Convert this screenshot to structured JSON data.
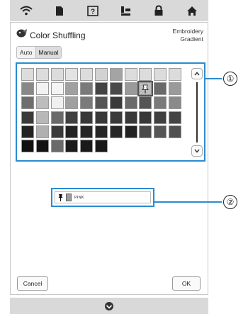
{
  "topbar": {
    "icons": [
      "wifi-icon",
      "document-icon",
      "help-icon",
      "embroidery-frame-icon",
      "lock-icon",
      "home-icon"
    ]
  },
  "header": {
    "title": "Color Shuffling",
    "mode_line1": "Embroidery",
    "mode_line2": "Gradient"
  },
  "tabs": {
    "auto_label": "Auto",
    "manual_label": "Manual",
    "active": "Manual"
  },
  "palette": {
    "rows": [
      [
        "#dcdcdc",
        "#dcdcdc",
        "#dcdcdc",
        "#e3e3e3",
        "#dcdcdc",
        "#d2d2d2",
        "#a4a4a4",
        "#dcdcdc",
        "#dcdcdc",
        "#dcdcdc",
        "#dcdcdc"
      ],
      [
        "#888888",
        "#f2f2f2",
        "#f4f4f4",
        "#a0a0a0",
        "#7a7a7a",
        "#444444",
        "#4a4a4a",
        "#9a9a9a",
        "#bdbdbd",
        "#6a6a6a",
        "#9a9a9a"
      ],
      [
        "#6e6e6e",
        "#bdbdbd",
        "#f0f0f0",
        "#a0a0a0",
        "#7a7a7a",
        "#555555",
        "#3a3a3a",
        "#6a6a6a",
        "#555555",
        "#7a7a7a",
        "#8a8a8a"
      ],
      [
        "#3a3a3a",
        "#b8b8b8",
        "#6a6a6a",
        "#404040",
        "#383838",
        "#383838",
        "#3a3a3a",
        "#383838",
        "#383838",
        "#404040",
        "#444444"
      ],
      [
        "#222222",
        "#b0b0b0",
        "#3a3a3a",
        "#222222",
        "#262626",
        "#262626",
        "#262626",
        "#222222",
        "#4a4a4a",
        "#555555",
        "#505050"
      ],
      [
        "#111111",
        "#141414",
        "#6a6a6a",
        "#1a1a1a",
        "#1a1a1a",
        "#181818"
      ]
    ],
    "selected_row": 1,
    "selected_col": 8,
    "selected_icon": "pin-icon"
  },
  "scroll": {
    "up_icon": "chevron-up-icon",
    "down_icon": "chevron-down-icon"
  },
  "selected_thread": {
    "icon": "pin-icon",
    "spool_icon": "spool-icon",
    "name": "PINK"
  },
  "buttons": {
    "cancel_label": "Cancel",
    "ok_label": "OK"
  },
  "bottombar": {
    "icon": "needle-position-icon"
  },
  "callouts": {
    "first": "①",
    "second": "②"
  },
  "colors": {
    "highlight_blue": "#2b8bd1",
    "bar_gray": "#d9d9d9"
  }
}
